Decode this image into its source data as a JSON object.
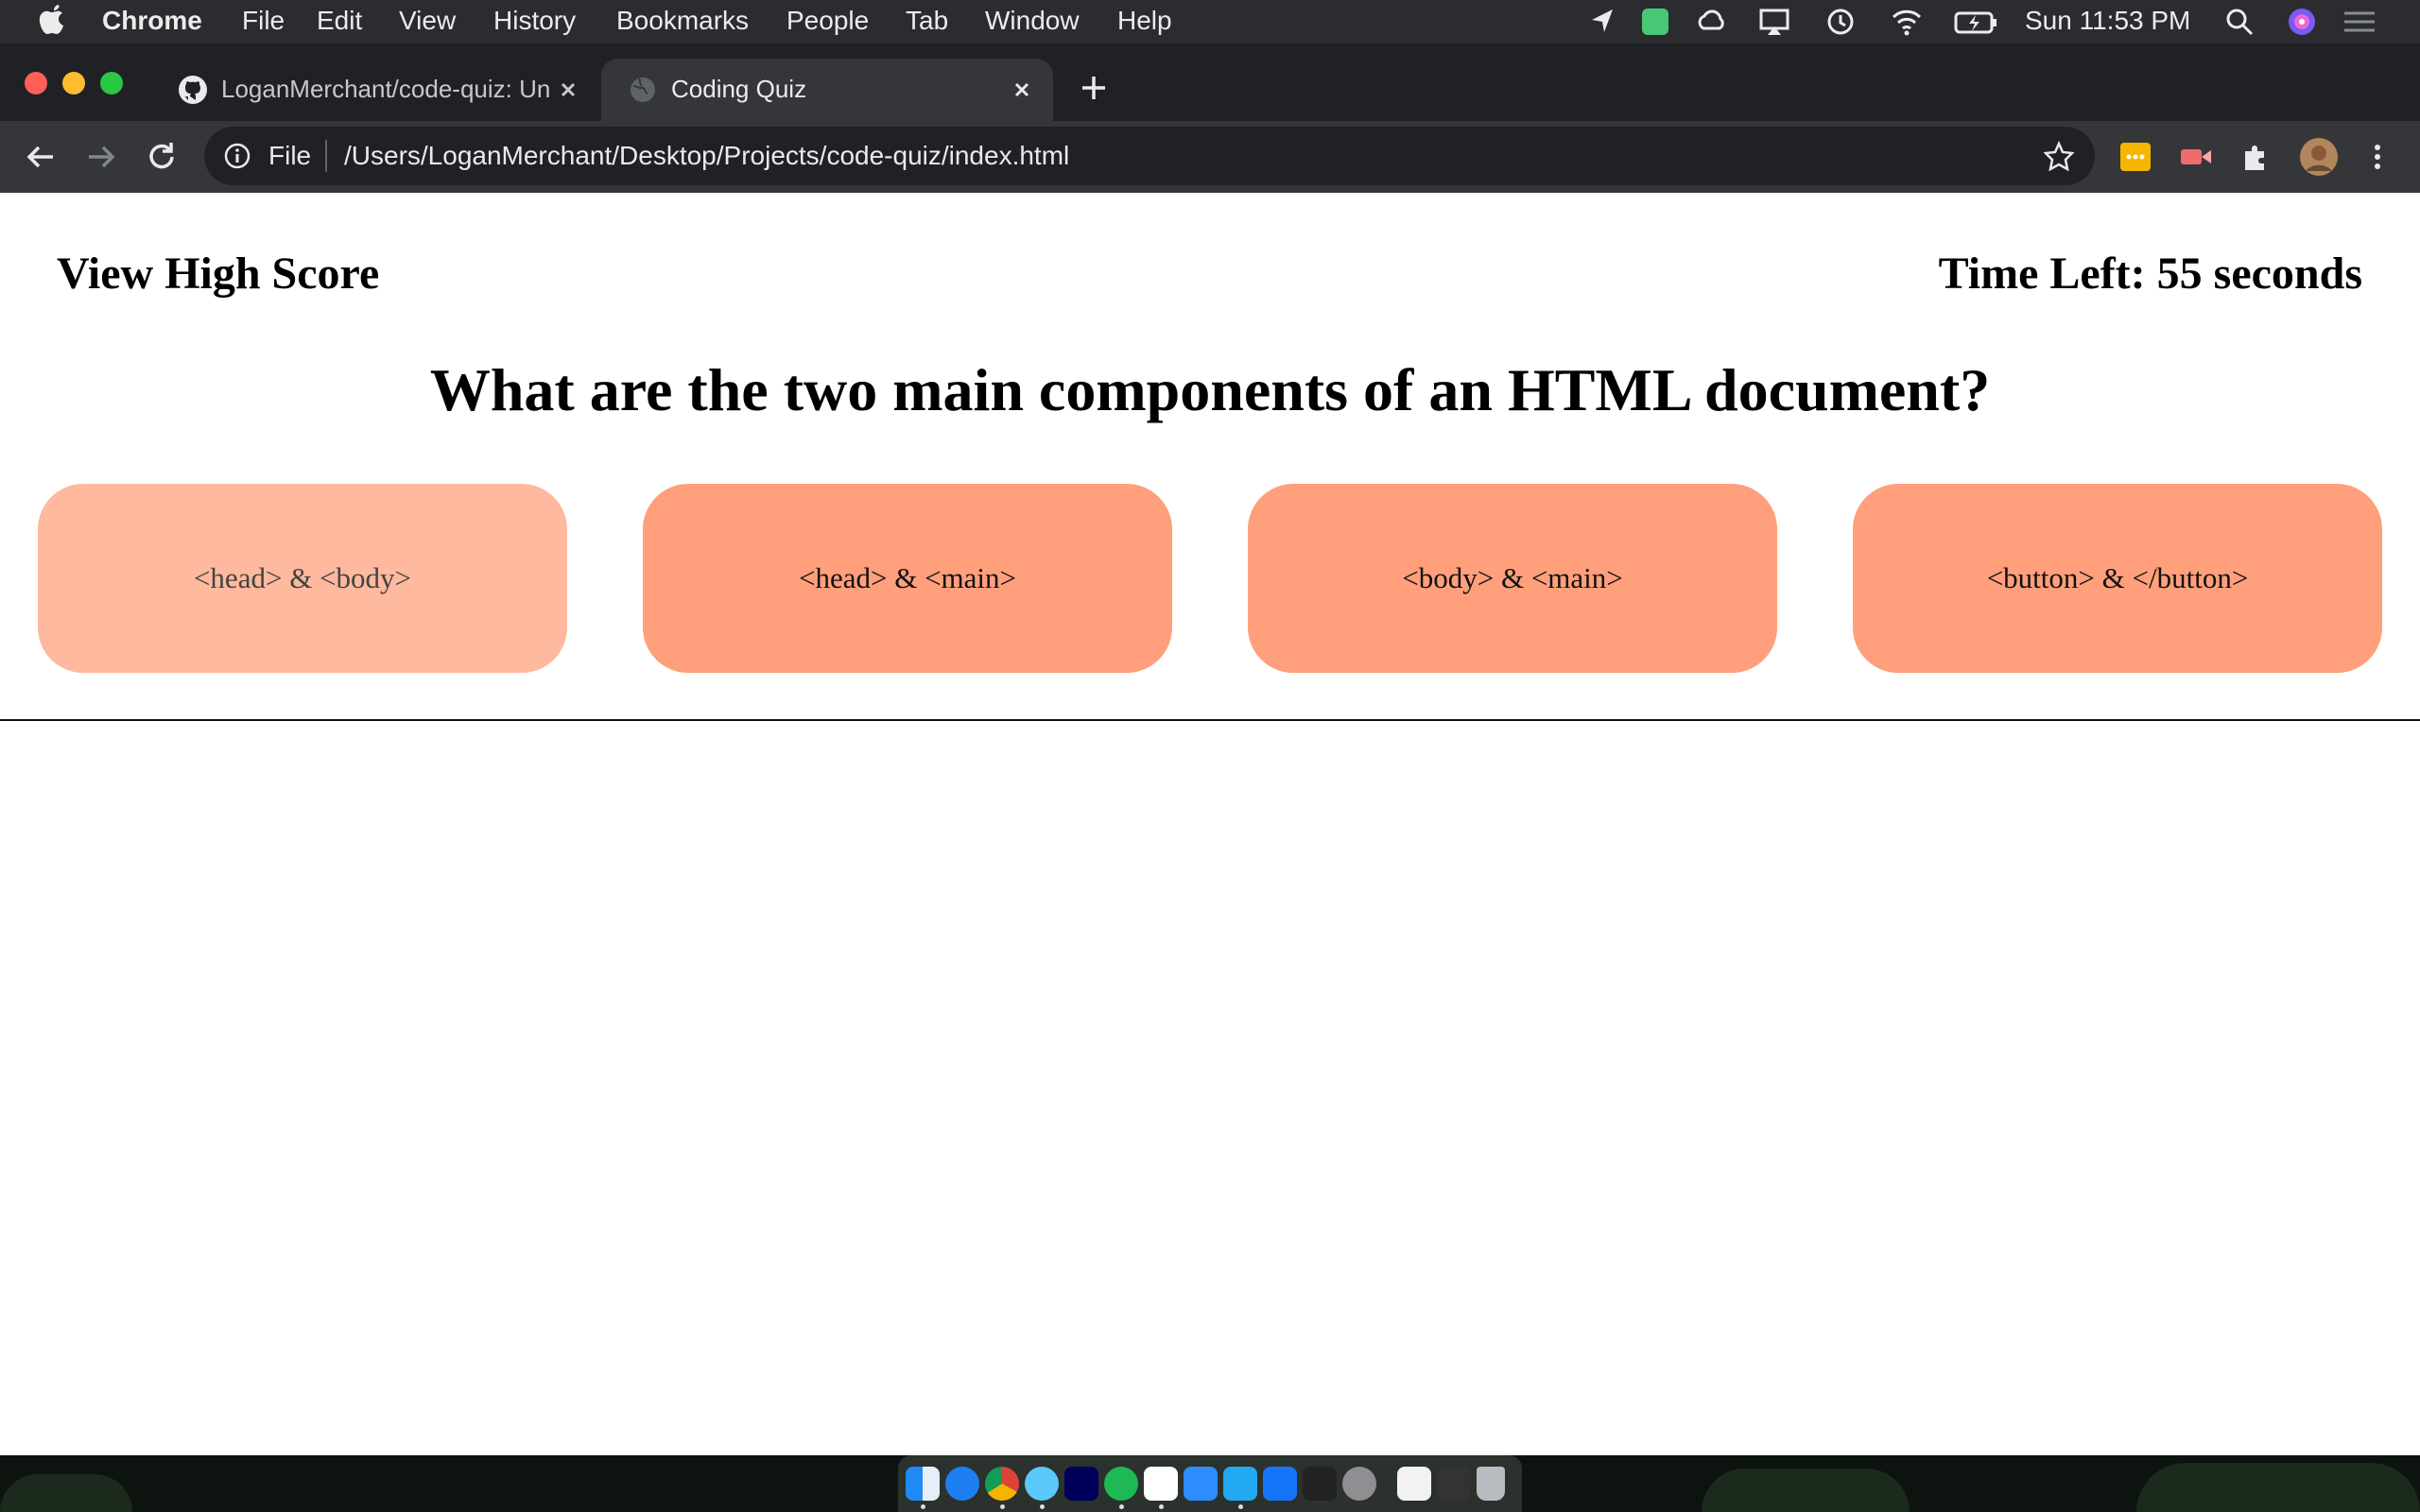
{
  "menubar": {
    "app_name": "Chrome",
    "menus": [
      "File",
      "Edit",
      "View",
      "History",
      "Bookmarks",
      "People",
      "Tab",
      "Window",
      "Help"
    ],
    "clock": "Sun 11:53 PM"
  },
  "tabs": [
    {
      "title": "LoganMerchant/code-quiz: Uni",
      "icon": "github-icon",
      "active": false
    },
    {
      "title": "Coding Quiz",
      "icon": "globe-icon",
      "active": true
    }
  ],
  "omnibox": {
    "scheme_label": "File",
    "url": "/Users/LoganMerchant/Desktop/Projects/code-quiz/index.html"
  },
  "quiz": {
    "view_high_score": "View High Score",
    "timer": "Time Left: 55 seconds",
    "question": "What are the two main components of an HTML document?",
    "answers": [
      "<head> & <body>",
      "<head> & <main>",
      "<body> & <main>",
      "<button> & </button>"
    ],
    "hovered_answer_index": 0
  },
  "colors": {
    "answer_bg": "#ff9f7b",
    "answer_hover_bg": "#ffb99e",
    "chrome_frame": "#202124",
    "chrome_toolbar": "#35363a"
  },
  "dock_apps": [
    "finder-icon",
    "app-store-icon",
    "chrome-icon",
    "messages-icon",
    "audition-icon",
    "spotify-icon",
    "slack-icon",
    "zoom-icon",
    "vscode-icon",
    "xcode-icon",
    "terminal-icon",
    "system-preferences-icon",
    "preview-icon",
    "activity-monitor-icon",
    "trash-icon"
  ]
}
